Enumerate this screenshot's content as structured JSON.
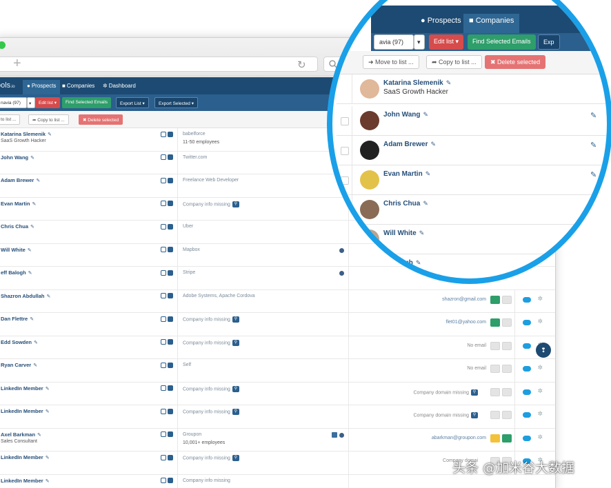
{
  "browser": {
    "new_tab_symbol": "+",
    "reload_symbol": "↻"
  },
  "app": {
    "brand": "ools",
    "brand_suffix": ".io",
    "tabs": [
      "Prospects",
      "Companies",
      "Dashboard"
    ],
    "active_tab": "Prospects"
  },
  "toolbar": {
    "list_select": "navia (97)",
    "edit_list": "Edit list ▾",
    "find_emails": "Find Selected Emails",
    "export_list": "Export List ▾",
    "export_selected": "Export Selected ▾"
  },
  "subbar": {
    "move_to_list": "to list ...",
    "copy_to_list": "Copy to list ...",
    "delete_selected": "Delete selected"
  },
  "rows": [
    {
      "name": "Katarina Slemenik",
      "title": "SaaS Growth Hacker",
      "company": "babelforce",
      "company_sub": "11-50 employees",
      "email": "",
      "email_state": "",
      "globe": false
    },
    {
      "name": "John Wang",
      "title": "",
      "company": "Twitter.com",
      "company_sub": "",
      "email": "",
      "email_state": "",
      "globe": false
    },
    {
      "name": "Adam Brewer",
      "title": "",
      "company": "Freelance Web Developer",
      "company_sub": "",
      "email": "",
      "email_state": "",
      "globe": false
    },
    {
      "name": "Evan Martin",
      "title": "",
      "company": "Company info missing",
      "company_sub": "",
      "email": "",
      "email_state": "",
      "globe": false,
      "mag": true
    },
    {
      "name": "Chris Chua",
      "title": "",
      "company": "Uber",
      "company_sub": "",
      "email": "",
      "email_state": "",
      "globe": false
    },
    {
      "name": "Will White",
      "title": "",
      "company": "Mapbox",
      "company_sub": "",
      "email": "",
      "email_state": "",
      "globe": true
    },
    {
      "name": "eff Balogh",
      "title": "",
      "company": "Stripe",
      "company_sub": "",
      "email": "",
      "email_state": "",
      "globe": true
    },
    {
      "name": "Shazron Abdullah",
      "title": "",
      "company": "Adobe Systems, Apache Cordova",
      "company_sub": "",
      "email": "shazron@gmail.com",
      "email_state": "green",
      "globe": false
    },
    {
      "name": "Dan Flettre",
      "title": "",
      "company": "Company info missing",
      "company_sub": "",
      "email": "flet01@yahoo.com",
      "email_state": "green",
      "globe": false,
      "mag": true
    },
    {
      "name": "Edd Sowden",
      "title": "",
      "company": "Company info missing",
      "company_sub": "",
      "email": "No email",
      "email_state": "grey",
      "globe": false,
      "mag": true
    },
    {
      "name": "Ryan Carver",
      "title": "",
      "company": "Self",
      "company_sub": "",
      "email": "No email",
      "email_state": "grey",
      "globe": false
    },
    {
      "name": "LinkedIn Member",
      "title": "",
      "company": "Company info missing",
      "company_sub": "",
      "email": "Company domain missing",
      "email_state": "grey",
      "globe": false,
      "mag": true
    },
    {
      "name": "LinkedIn Member",
      "title": "",
      "company": "Company info missing",
      "company_sub": "",
      "email": "Company domain missing",
      "email_state": "grey",
      "globe": false,
      "mag": true
    },
    {
      "name": "Axel Barkman",
      "title": "Sales Consultant",
      "company": "Groupon",
      "company_sub": "10,001+ employees",
      "email": "abarkman@groupon.com",
      "email_state": "yellow",
      "globe": true,
      "linkedin": true
    },
    {
      "name": "LinkedIn Member",
      "title": "",
      "company": "Company info missing",
      "company_sub": "",
      "email": "Company domai",
      "email_state": "grey",
      "globe": false,
      "mag": true
    },
    {
      "name": "LinkedIn Member",
      "title": "",
      "company": "Company info missing",
      "company_sub": "",
      "email": "",
      "email_state": "",
      "globe": false
    }
  ],
  "magnifier": {
    "tabs": [
      "Prospects",
      "Companies"
    ],
    "list_select": "avia (97)",
    "edit_list": "Edit list ▾",
    "find_emails": "Find Selected Emails",
    "export": "Exp",
    "move_to_list": "Move to list ...",
    "copy_to_list": "Copy to list ...",
    "delete_selected": "Delete selected",
    "rows": [
      {
        "name": "Katarina Slemenik",
        "title": "SaaS Growth Hacker",
        "avatar_color": "#e0b89a"
      },
      {
        "name": "John Wang",
        "title": "",
        "avatar_color": "#6b3b2e"
      },
      {
        "name": "Adam Brewer",
        "title": "",
        "avatar_color": "#222222"
      },
      {
        "name": "Evan Martin",
        "title": "",
        "avatar_color": "#e3c24a"
      },
      {
        "name": "Chris Chua",
        "title": "",
        "avatar_color": "#8a6b55"
      },
      {
        "name": "Will White",
        "title": "",
        "avatar_color": "#b9a58f"
      },
      {
        "name": "eff Balogh",
        "title": "",
        "avatar_color": ""
      }
    ]
  },
  "watermark": "头条 @加米谷大数据",
  "colors": {
    "nav": "#1d4a72",
    "toolbar": "#2b5f8d",
    "accent_ring": "#1aa0e8",
    "red": "#d64b4b",
    "green": "#2e9e6a"
  }
}
